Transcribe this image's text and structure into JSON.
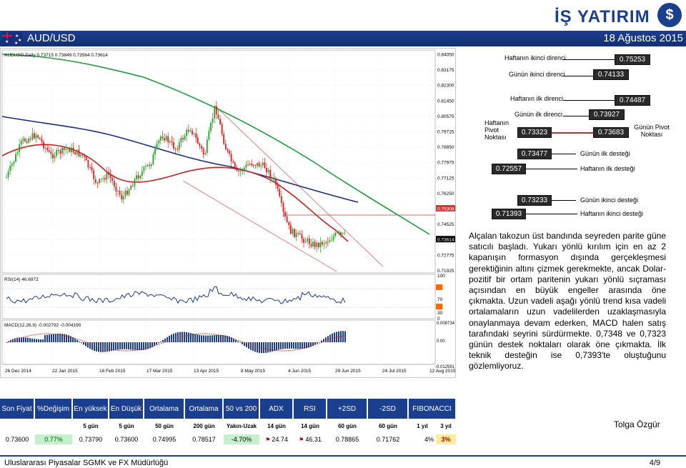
{
  "brand": {
    "logo_text": "İŞ YATIRIM",
    "logo_mark": "$"
  },
  "header": {
    "pair": "AUD/USD",
    "date": "18 Ağustos 2015"
  },
  "chart": {
    "ohlc_label": "AUDUSD,Daily  0.73715 0.73849 0.73564 0.73614",
    "rsi_label": "RSI(14) 46.6972",
    "macd_label": "MACD(12,26,9) -0.002792 -0.004190",
    "price_ticks": [
      "0.84050",
      "0.83175",
      "0.82300",
      "0.81450",
      "0.80575",
      "0.79725",
      "0.78850",
      "0.77975",
      "0.77125",
      "0.76250",
      "0.75308",
      "0.74525",
      "0.73614",
      "0.72775",
      "0.71925"
    ],
    "rsi_ticks": [
      "100",
      "70",
      "30",
      "0"
    ],
    "macd_ticks": [
      "0.008734",
      "0.00",
      "-0.012591"
    ],
    "date_ticks": [
      "26 Dec 2014",
      "22 Jan 2015",
      "18 Feb 2015",
      "17 Mar 2015",
      "13 Apr 2015",
      "8 May 2015",
      "4 Jun 2015",
      "29 Jun 2015",
      "24 Jul 2015",
      "12 Aug 2015"
    ]
  },
  "pivots": {
    "weekly_r2": {
      "label": "Haftanın ikinci direnci",
      "value": "0.75253"
    },
    "daily_r2": {
      "label": "Günün ikinci direnci",
      "value": "0.74133"
    },
    "weekly_r1": {
      "label": "Haftanın ilk direnci",
      "value": "0.74487"
    },
    "daily_r1": {
      "label": "Günün ilk direnci",
      "value": "0.73927"
    },
    "weekly_pivot": {
      "label": "Haftanın Pivot Noktası",
      "value": "0.73323"
    },
    "daily_pivot": {
      "label": "Günün Pivot Noktası",
      "value": "0.73683"
    },
    "daily_s1": {
      "label": "Günün ilk desteği",
      "value": "0.73477"
    },
    "weekly_s1": {
      "label": "Haftanın ilk desteği",
      "value": "0.72557"
    },
    "daily_s2": {
      "label": "Günün ikinci desteği",
      "value": "0.73233"
    },
    "weekly_s2": {
      "label": "Haftanın ikinci desteği",
      "value": "0.71393"
    }
  },
  "commentary": "Alçalan takozun üst bandında seyreden parite güne satıcılı başladı. Yukarı yönlü kırılım için en az 2 kapanışın formasyon dışında gerçekleşmesi gerektiğinin altını çizmek gerekmekte, ancak Dolar-pozitif bir ortam paritenin yukarı yönlü sıçraması açısından en büyük engeller arasında öne çıkmakta. Uzun vadeli aşağı yönlü trend kısa vadeli ortalamaların uzun vadelilerden uzaklaşmasıyla onaylanmaya devam ederken, MACD halen satış tarafındaki seyrini sürdürmekte. 0,7348 ve 0,7323 günün destek noktaları olarak öne çıkmakta. İlk teknik desteğin ise 0,7393'te oluştuğunu gözlemliyoruz.",
  "table": {
    "headers": [
      "Son Fiyat",
      "%Değişim",
      "En yüksek",
      "En Düşük",
      "Ortalama",
      "Ortalama",
      "50 vs 200",
      "ADX",
      "RSI",
      "+2SD",
      "-2SD",
      "FIBONACCI"
    ],
    "subheaders": [
      "",
      "",
      "5 gün",
      "5 gün",
      "50 gün",
      "200 gün",
      "Yakın-Uzak",
      "14 gün",
      "14 gün",
      "60 gün",
      "60 gün",
      "1 yıl",
      "3 yıl"
    ],
    "values": [
      "0.73600",
      "0.77%",
      "0.73790",
      "0.73600",
      "0.74995",
      "0.78517",
      "-4.70%",
      "24.74",
      "46.31",
      "0.78865",
      "0.71762",
      "4%",
      "3%"
    ]
  },
  "author": "Tolga Özgür",
  "footer": {
    "department": "Uluslararası Piyasalar SGMK ve FX Müdürlüğü",
    "page": "4/9"
  },
  "colors": {
    "brand_blue": "#1b3f8f",
    "pivot_box": "#ffe8e0",
    "pivot_dark": "#2a2a2a",
    "green_cell": "#c6efce",
    "yellow_cell": "#ffeb9c",
    "red_text": "#c00000"
  }
}
